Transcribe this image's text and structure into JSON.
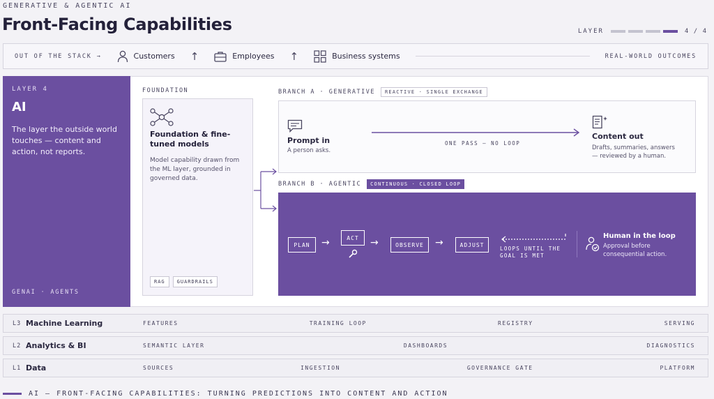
{
  "header": {
    "eyebrow": "GENERATIVE & AGENTIC AI",
    "title": "Front-Facing Capabilities",
    "layer_label": "LAYER",
    "layer_count": "4 / 4",
    "layer_progress": 0.75
  },
  "stack": {
    "out_label": "OUT OF THE STACK →",
    "customers": "Customers",
    "employees": "Employees",
    "business": "Business systems",
    "outcomes": "REAL-WORLD OUTCOMES"
  },
  "layer4": {
    "label": "LAYER 4",
    "title": "AI",
    "desc": "The layer the outside world touches — content and action, not reports.",
    "foot": "GENAI · AGENTS"
  },
  "foundation": {
    "label": "FOUNDATION",
    "title": "Foundation & fine-tuned models",
    "desc": "Model capability drawn from the ML layer, grounded in governed data.",
    "tags": [
      "RAG",
      "GUARDRAILS"
    ]
  },
  "branch_a": {
    "label": "BRANCH A · GENERATIVE",
    "pill": "REACTIVE · SINGLE EXCHANGE",
    "prompt_title": "Prompt in",
    "prompt_desc": "A person asks.",
    "pass_label": "ONE PASS — NO LOOP",
    "content_title": "Content out",
    "content_desc": "Drafts, summaries, answers — reviewed by a human."
  },
  "branch_b": {
    "label": "BRANCH B · AGENTIC",
    "pill": "CONTINUOUS · CLOSED LOOP",
    "steps": [
      "PLAN",
      "ACT",
      "OBSERVE",
      "ADJUST"
    ],
    "loop_text": "LOOPS UNTIL THE GOAL IS MET",
    "human_title": "Human in the loop",
    "human_desc": "Approval before consequential action."
  },
  "layers": [
    {
      "code": "L3",
      "name": "Machine Learning",
      "items": [
        "FEATURES",
        "TRAINING LOOP",
        "REGISTRY",
        "SERVING"
      ]
    },
    {
      "code": "L2",
      "name": "Analytics & BI",
      "items": [
        "SEMANTIC LAYER",
        "DASHBOARDS",
        "DIAGNOSTICS"
      ]
    },
    {
      "code": "L1",
      "name": "Data",
      "items": [
        "SOURCES",
        "INGESTION",
        "GOVERNANCE GATE",
        "PLATFORM"
      ]
    }
  ],
  "footer": {
    "caption": "AI — FRONT-FACING CAPABILITIES: TURNING PREDICTIONS INTO CONTENT AND ACTION"
  },
  "colors": {
    "accent": "#6b4fa0",
    "panel": "#f5f3fa",
    "ink": "#24213a"
  },
  "icons": [
    "person-icon",
    "briefcase-icon",
    "grid-icon",
    "network-icon",
    "chat-icon",
    "document-icon",
    "wrench-icon",
    "person-check-icon"
  ]
}
